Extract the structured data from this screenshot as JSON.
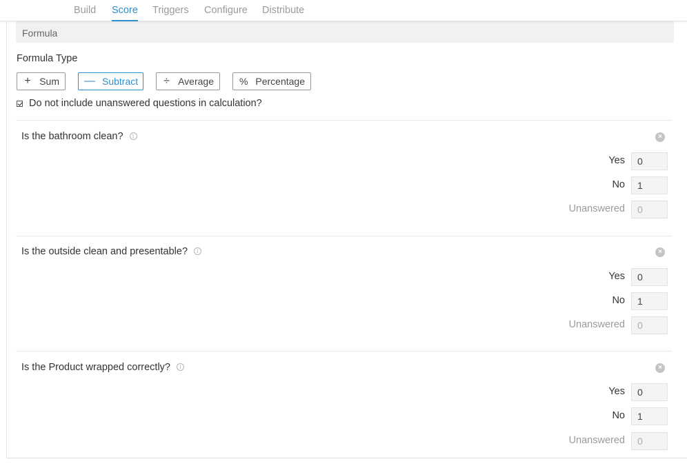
{
  "nav": {
    "tabs": [
      {
        "label": "Build"
      },
      {
        "label": "Score",
        "active": true
      },
      {
        "label": "Triggers"
      },
      {
        "label": "Configure"
      },
      {
        "label": "Distribute"
      }
    ]
  },
  "formula": {
    "header": "Formula",
    "type_label": "Formula Type",
    "buttons": [
      {
        "label": "Sum",
        "icon": "plus-icon"
      },
      {
        "label": "Subtract",
        "icon": "minus-icon",
        "selected": true
      },
      {
        "label": "Average",
        "icon": "divide-icon"
      },
      {
        "label": "Percentage",
        "icon": "percent-icon"
      }
    ],
    "exclude_unanswered": {
      "label": "Do not include unanswered questions in calculation?",
      "checked": true
    }
  },
  "questions": [
    {
      "title": "Is the bathroom clean?",
      "answers": [
        {
          "label": "Yes",
          "value": "0"
        },
        {
          "label": "No",
          "value": "1"
        },
        {
          "label": "Unanswered",
          "value": "0",
          "muted": true
        }
      ]
    },
    {
      "title": "Is the outside clean and presentable?",
      "answers": [
        {
          "label": "Yes",
          "value": "0"
        },
        {
          "label": "No",
          "value": "1"
        },
        {
          "label": "Unanswered",
          "value": "0",
          "muted": true
        }
      ]
    },
    {
      "title": "Is the Product wrapped correctly?",
      "answers": [
        {
          "label": "Yes",
          "value": "0"
        },
        {
          "label": "No",
          "value": "1"
        },
        {
          "label": "Unanswered",
          "value": "0",
          "muted": true
        }
      ]
    }
  ],
  "colors": {
    "accent": "#2d8fd0",
    "muted_text": "#9a9a9a",
    "header_bg": "#f1f1f1"
  }
}
